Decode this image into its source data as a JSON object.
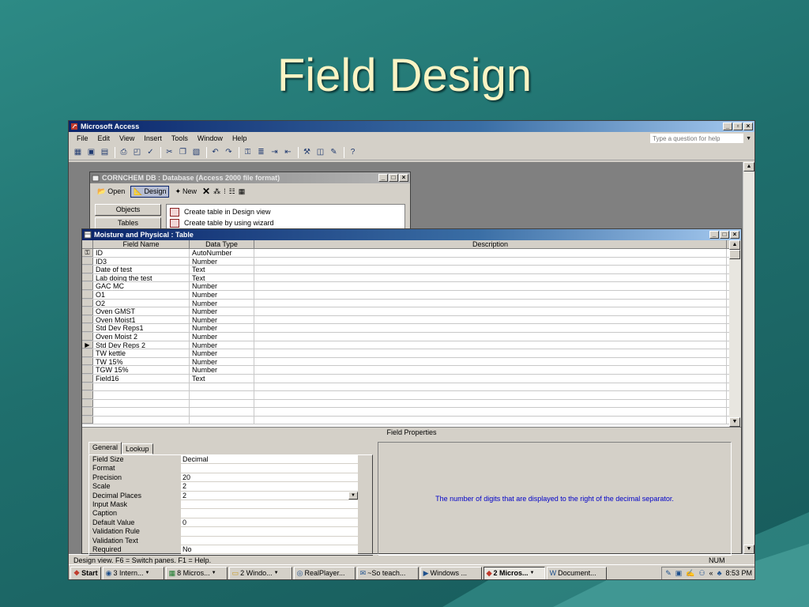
{
  "slide_title": "Field Design",
  "app": {
    "title": "Microsoft Access",
    "menu": [
      "File",
      "Edit",
      "View",
      "Insert",
      "Tools",
      "Window",
      "Help"
    ],
    "help_placeholder": "Type a question for help"
  },
  "db_window": {
    "title": "CORNCHEM DB : Database (Access 2000 file format)",
    "buttons": {
      "open": "Open",
      "design": "Design",
      "new": "New"
    },
    "objects_label": "Objects",
    "tables_label": "Tables",
    "list": [
      "Create table in Design view",
      "Create table by using wizard"
    ]
  },
  "table_window": {
    "title": "Moisture and Physical : Table",
    "columns": [
      "Field Name",
      "Data Type",
      "Description"
    ],
    "rows": [
      {
        "name": "ID",
        "type": "AutoNumber",
        "marker": "key"
      },
      {
        "name": "ID3",
        "type": "Number",
        "marker": ""
      },
      {
        "name": "Date of test",
        "type": "Text",
        "marker": ""
      },
      {
        "name": "Lab doing the test",
        "type": "Text",
        "marker": ""
      },
      {
        "name": "GAC MC",
        "type": "Number",
        "marker": ""
      },
      {
        "name": "O1",
        "type": "Number",
        "marker": ""
      },
      {
        "name": "O2",
        "type": "Number",
        "marker": ""
      },
      {
        "name": "Oven GMST",
        "type": "Number",
        "marker": ""
      },
      {
        "name": "Oven Moist1",
        "type": "Number",
        "marker": ""
      },
      {
        "name": "Std Dev Reps1",
        "type": "Number",
        "marker": ""
      },
      {
        "name": "Oven Moist 2",
        "type": "Number",
        "marker": ""
      },
      {
        "name": "Std Dev Reps 2",
        "type": "Number",
        "marker": "current"
      },
      {
        "name": "TW kettle",
        "type": "Number",
        "marker": ""
      },
      {
        "name": "TW 15%",
        "type": "Number",
        "marker": ""
      },
      {
        "name": "TGW 15%",
        "type": "Number",
        "marker": ""
      },
      {
        "name": "Field16",
        "type": "Text",
        "marker": ""
      }
    ],
    "field_properties_label": "Field Properties",
    "tabs": [
      "General",
      "Lookup"
    ],
    "properties": [
      {
        "label": "Field Size",
        "value": "Decimal"
      },
      {
        "label": "Format",
        "value": ""
      },
      {
        "label": "Precision",
        "value": "20"
      },
      {
        "label": "Scale",
        "value": "2"
      },
      {
        "label": "Decimal Places",
        "value": "2"
      },
      {
        "label": "Input Mask",
        "value": ""
      },
      {
        "label": "Caption",
        "value": ""
      },
      {
        "label": "Default Value",
        "value": "0"
      },
      {
        "label": "Validation Rule",
        "value": ""
      },
      {
        "label": "Validation Text",
        "value": ""
      },
      {
        "label": "Required",
        "value": "No"
      }
    ],
    "help_text": "The number of digits that are displayed to the right of the decimal separator."
  },
  "status": {
    "text": "Design view.  F6 = Switch panes.  F1 = Help.",
    "num": "NUM"
  },
  "taskbar": {
    "start": "Start",
    "items": [
      "3 Intern...",
      "8 Micros...",
      "2 Windo...",
      "RealPlayer...",
      "~So teach...",
      "Windows ...",
      "2 Micros...",
      "Document..."
    ],
    "clock": "8:53 PM"
  }
}
